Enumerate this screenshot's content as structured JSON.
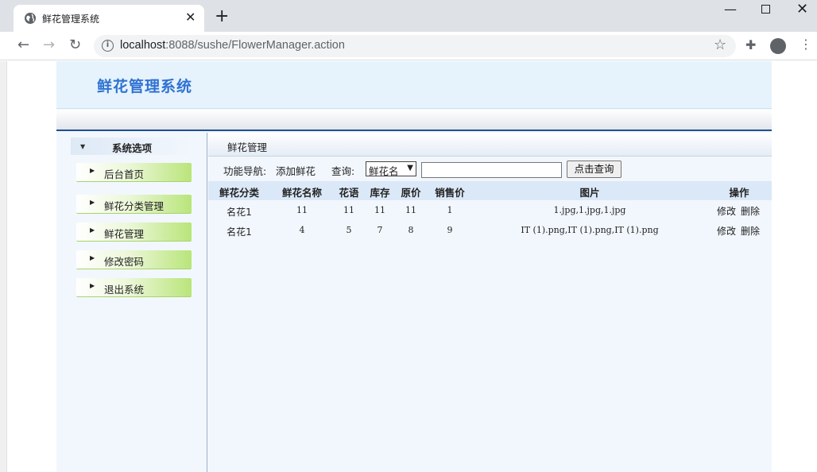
{
  "browser": {
    "tab_title": "鲜花管理系统",
    "url_host": "localhost",
    "url_rest": ":8088/sushe/FlowerManager.action"
  },
  "app": {
    "title": "鲜花管理系统"
  },
  "sidebar": {
    "header": "系统选项",
    "items": [
      {
        "label": "后台首页"
      },
      {
        "label": "鲜花分类管理"
      },
      {
        "label": "鲜花管理"
      },
      {
        "label": "修改密码"
      },
      {
        "label": "退出系统"
      }
    ]
  },
  "main": {
    "header": "鲜花管理",
    "nav_label": "功能导航:",
    "add_link": "添加鲜花",
    "query_label": "查询:",
    "select_value": "鲜花名",
    "search_value": "",
    "search_button": "点击查询"
  },
  "table": {
    "headers": [
      "鲜花分类",
      "鲜花名称",
      "花语",
      "库存",
      "原价",
      "销售价",
      "图片",
      "操作"
    ],
    "rows": [
      {
        "category": "名花1",
        "name": "11",
        "language": "11",
        "stock": "11",
        "price": "11",
        "sale": "1",
        "images": "1.jpg,1.jpg,1.jpg",
        "edit": "修改",
        "delete": "删除"
      },
      {
        "category": "名花1",
        "name": "4",
        "language": "5",
        "stock": "7",
        "price": "8",
        "sale": "9",
        "images": "IT (1).png,IT (1).png,IT (1).png",
        "edit": "修改",
        "delete": "删除"
      }
    ]
  },
  "colors": {
    "title_blue": "#2f72d2",
    "header_navy": "#1f4f8d",
    "menu_green": "#b9e57a",
    "table_head": "#dbe8f7"
  }
}
